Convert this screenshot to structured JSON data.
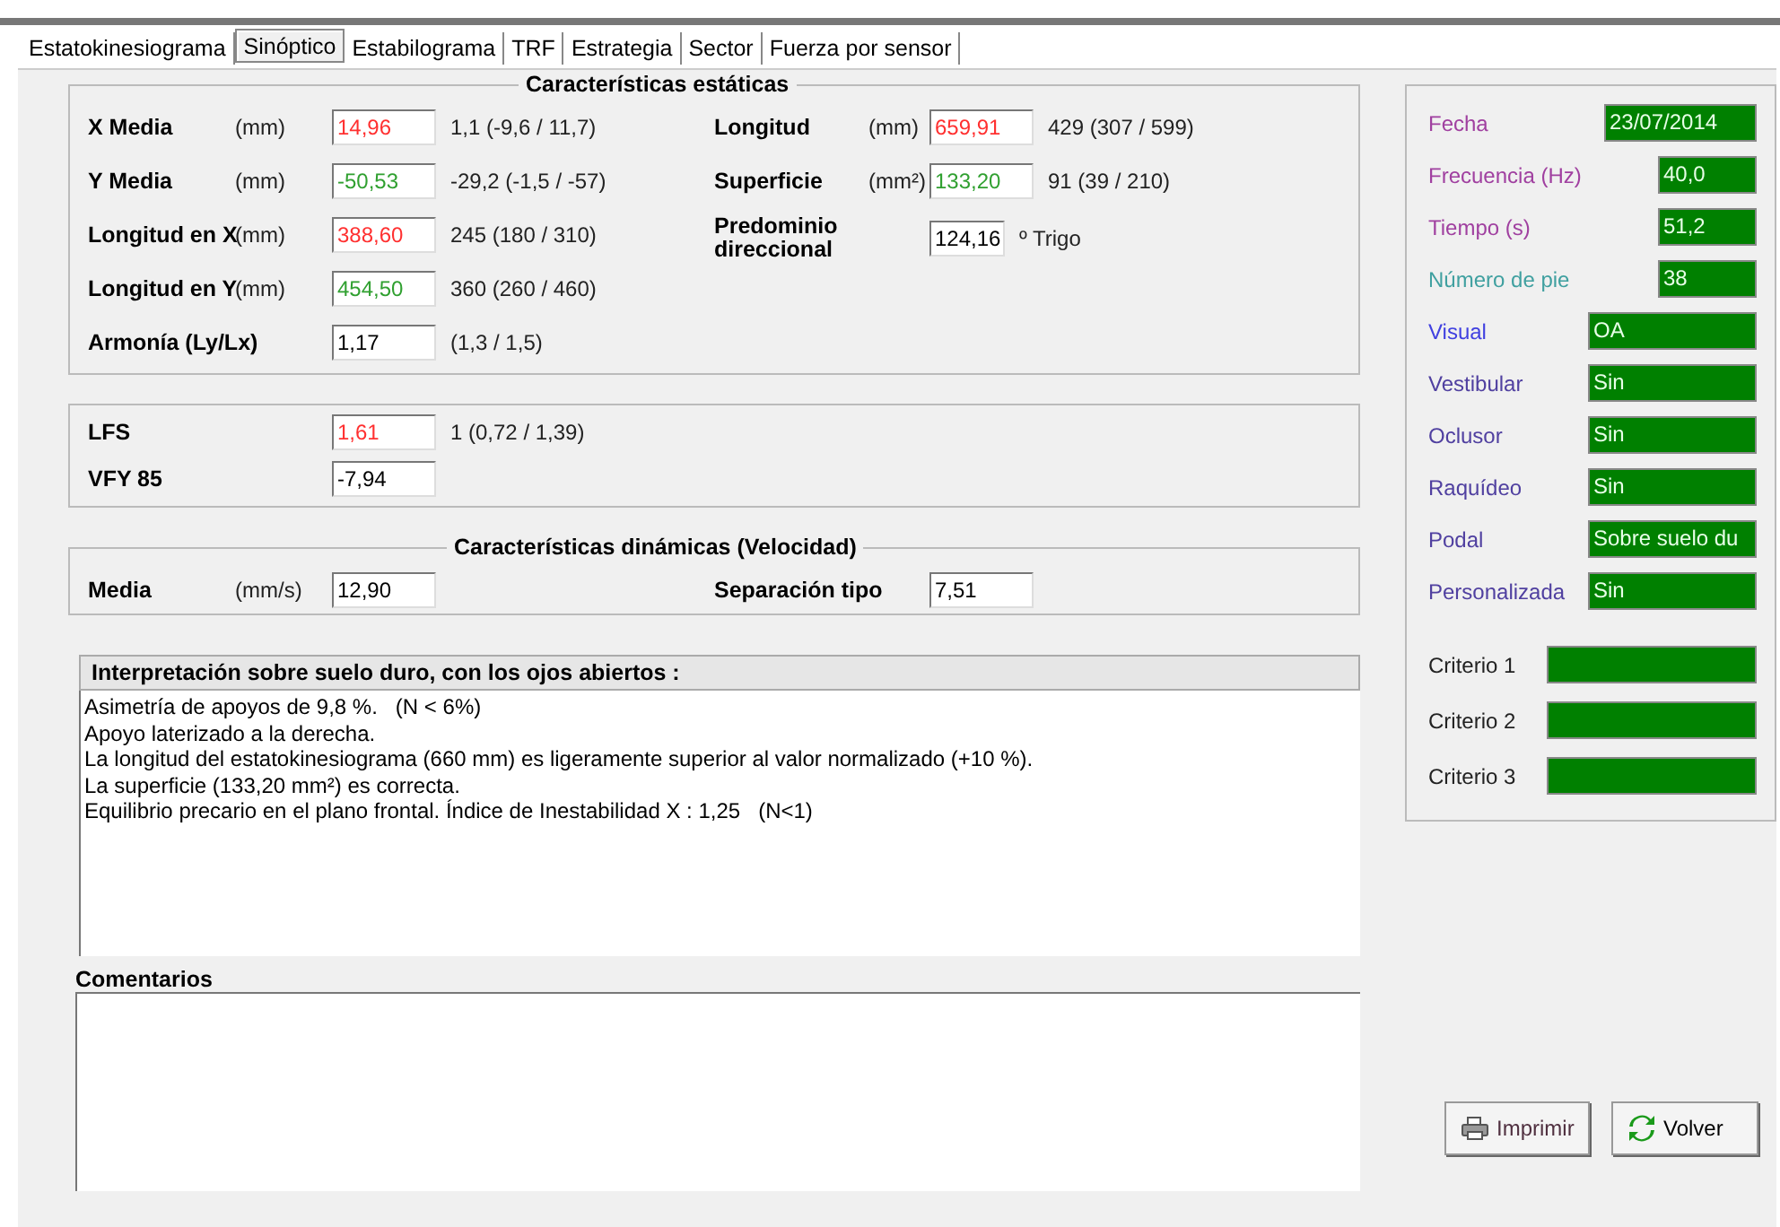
{
  "tabs": [
    {
      "label": "Estatokinesiograma",
      "selected": false
    },
    {
      "label": "Sinóptico",
      "selected": true
    },
    {
      "label": "Estabilograma",
      "selected": false
    },
    {
      "label": "TRF",
      "selected": false
    },
    {
      "label": "Estrategia",
      "selected": false
    },
    {
      "label": "Sector",
      "selected": false
    },
    {
      "label": "Fuerza por sensor",
      "selected": false
    }
  ],
  "static": {
    "title": "Características estáticas",
    "left_rows": [
      {
        "label": "X Media",
        "unit": "(mm)",
        "value": "14,96",
        "color": "#ff3030",
        "reference": "1,1 (-9,6 / 11,7)"
      },
      {
        "label": "Y Media",
        "unit": "(mm)",
        "value": "-50,53",
        "color": "#30a030",
        "reference": "-29,2 (-1,5 / -57)"
      },
      {
        "label": "Longitud en X",
        "unit": "(mm)",
        "value": "388,60",
        "color": "#ff3030",
        "reference": "245 (180 / 310)"
      },
      {
        "label": "Longitud en Y",
        "unit": "(mm)",
        "value": "454,50",
        "color": "#30a030",
        "reference": "360 (260 / 460)"
      },
      {
        "label": "Armonía (Ly/Lx)",
        "value": "1,17",
        "color": "#000000",
        "reference": "(1,3 / 1,5)"
      }
    ],
    "right_rows": [
      {
        "label": "Longitud",
        "unit": "(mm)",
        "value": "659,91",
        "color": "#ff3030",
        "reference": "429 (307 / 599)"
      },
      {
        "label": "Superficie",
        "unit": "(mm²)",
        "value": "133,20",
        "color": "#30a030",
        "reference": "91 (39 / 210)"
      },
      {
        "label": "Predominio direccional",
        "value": "124,16",
        "color": "#000000",
        "reference": "º Trigo"
      }
    ]
  },
  "indices": [
    {
      "label": "LFS",
      "value": "1,61",
      "color": "#ff3030",
      "reference": "1 (0,72 / 1,39)"
    },
    {
      "label": "VFY 85",
      "value": "-7,94",
      "color": "#000000"
    }
  ],
  "dynamic": {
    "title": "Características dinámicas (Velocidad)",
    "rows": [
      {
        "label": "Media",
        "unit": "(mm/s)",
        "value": "12,90"
      },
      {
        "label": "Separación tipo",
        "value": "7,51"
      }
    ]
  },
  "interpretation": {
    "title": "Interpretación sobre suelo duro, con los ojos abiertos :",
    "lines": [
      "Asimetría de apoyos de 9,8 %.   (N < 6%)",
      "Apoyo laterizado a la derecha.",
      "La longitud del estatokinesiograma (660 mm) es ligeramente superior al valor normalizado (+10 %).",
      "La superficie (133,20 mm²) es correcta.",
      "Equilibrio precario en el plano frontal. Índice de Inestabilidad X : 1,25   (N<1)"
    ]
  },
  "comments": {
    "label": "Comentarios"
  },
  "info": [
    {
      "label": "Fecha",
      "value": "23/07/2014",
      "color": "#a040a0",
      "kind": "date"
    },
    {
      "label": "Frecuencia (Hz)",
      "value": "40,0",
      "color": "#a040a0",
      "kind": "number"
    },
    {
      "label": "Tiempo (s)",
      "value": "51,2",
      "color": "#a040a0",
      "kind": "number"
    },
    {
      "label": "Número de pie",
      "value": "38",
      "color": "#40a0a0",
      "kind": "number"
    },
    {
      "label": "Visual",
      "value": "OA",
      "color": "#4040e0",
      "kind": "text"
    },
    {
      "label": "Vestibular",
      "value": "Sin",
      "color": "#5040a0",
      "kind": "text"
    },
    {
      "label": "Oclusor",
      "value": "Sin",
      "color": "#5040a0",
      "kind": "text"
    },
    {
      "label": "Raquídeo",
      "value": "Sin",
      "color": "#5040a0",
      "kind": "text"
    },
    {
      "label": "Podal",
      "value": "Sobre suelo du",
      "color": "#5040a0",
      "kind": "text"
    },
    {
      "label": "Personalizada",
      "value": "Sin",
      "color": "#5040a0",
      "kind": "text"
    }
  ],
  "criteria": [
    {
      "label": "Criterio 1"
    },
    {
      "label": "Criterio 2"
    },
    {
      "label": "Criterio 3"
    }
  ],
  "buttons": [
    {
      "label": "Imprimir",
      "kind": "print"
    },
    {
      "label": "Volver",
      "kind": "back"
    }
  ]
}
